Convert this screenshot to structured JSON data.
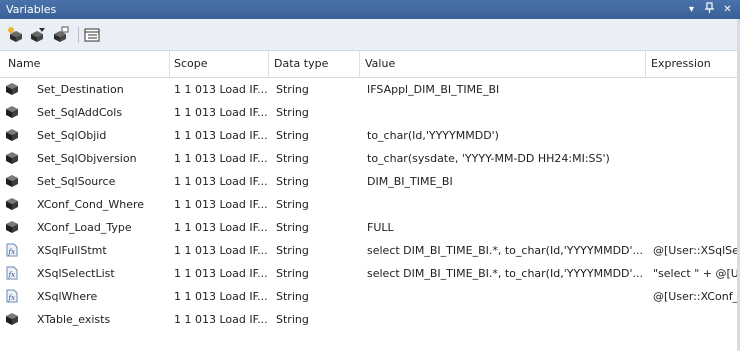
{
  "window": {
    "title": "Variables"
  },
  "titlebar_buttons": {
    "dropdown": "▾",
    "pin": "ᛘ",
    "close": "✕"
  },
  "toolbar": {
    "buttons": [
      {
        "icon": "add-variable-icon"
      },
      {
        "icon": "delete-variable-icon"
      },
      {
        "icon": "move-variable-icon"
      },
      {
        "icon": "grid-options-icon"
      }
    ]
  },
  "columns": [
    "Name",
    "Scope",
    "Data type",
    "Value",
    "Expression"
  ],
  "rows": [
    {
      "name": "Set_Destination",
      "scope": "1 1 013 Load IF...",
      "type": "String",
      "value": "IFSAppl_DIM_BI_TIME_BI",
      "expression": "",
      "icon": "variable-icon"
    },
    {
      "name": "Set_SqlAddCols",
      "scope": "1 1 013 Load IF...",
      "type": "String",
      "value": "",
      "expression": "",
      "icon": "variable-icon"
    },
    {
      "name": "Set_SqlObjid",
      "scope": "1 1 013 Load IF...",
      "type": "String",
      "value": "to_char(Id,'YYYYMMDD')",
      "expression": "",
      "icon": "variable-icon"
    },
    {
      "name": "Set_SqlObjversion",
      "scope": "1 1 013 Load IF...",
      "type": "String",
      "value": "to_char(sysdate, 'YYYY-MM-DD HH24:MI:SS')",
      "expression": "",
      "icon": "variable-icon"
    },
    {
      "name": "Set_SqlSource",
      "scope": "1 1 013 Load IF...",
      "type": "String",
      "value": "DIM_BI_TIME_BI",
      "expression": "",
      "icon": "variable-icon"
    },
    {
      "name": "XConf_Cond_Where",
      "scope": "1 1 013 Load IF...",
      "type": "String",
      "value": "",
      "expression": "",
      "icon": "variable-icon"
    },
    {
      "name": "XConf_Load_Type",
      "scope": "1 1 013 Load IF...",
      "type": "String",
      "value": "FULL",
      "expression": "",
      "icon": "variable-icon"
    },
    {
      "name": "XSqlFullStmt",
      "scope": "1 1 013 Load IF...",
      "type": "String",
      "value": "select DIM_BI_TIME_BI.*, to_char(Id,'YYYYMMDD'...",
      "expression": "@[User::XSqlSe",
      "icon": "expression-variable-icon"
    },
    {
      "name": "XSqlSelectList",
      "scope": "1 1 013 Load IF...",
      "type": "String",
      "value": "select DIM_BI_TIME_BI.*, to_char(Id,'YYYYMMDD'...",
      "expression": "\"select \"  + @[U",
      "icon": "expression-variable-icon"
    },
    {
      "name": "XSqlWhere",
      "scope": "1 1 013 Load IF...",
      "type": "String",
      "value": "",
      "expression": "@[User::XConf_",
      "icon": "expression-variable-icon"
    },
    {
      "name": "XTable_exists",
      "scope": "1 1 013 Load IF...",
      "type": "String",
      "value": "",
      "expression": "",
      "icon": "variable-icon"
    }
  ]
}
